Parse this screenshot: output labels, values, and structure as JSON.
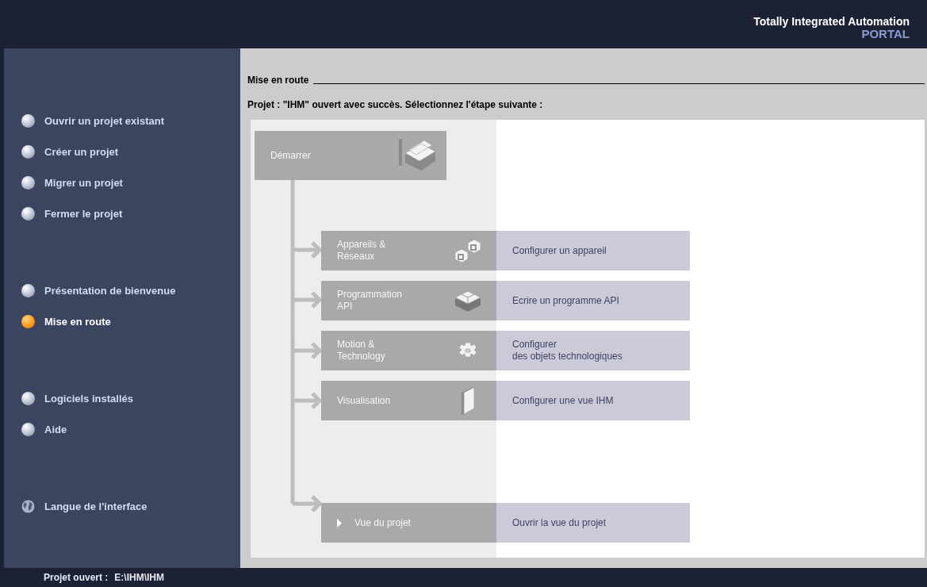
{
  "header": {
    "title": "Totally Integrated Automation",
    "subtitle": "PORTAL"
  },
  "sidebar": {
    "groups": [
      [
        {
          "label": "Ouvrir un projet existant",
          "kind": "bullet",
          "selected": false
        },
        {
          "label": "Créer un projet",
          "kind": "bullet",
          "selected": false
        },
        {
          "label": "Migrer un projet",
          "kind": "bullet",
          "selected": false
        },
        {
          "label": "Fermer le projet",
          "kind": "bullet",
          "selected": false
        }
      ],
      [
        {
          "label": "Présentation de bienvenue",
          "kind": "bullet",
          "selected": false
        },
        {
          "label": "Mise en route",
          "kind": "bullet",
          "selected": true
        }
      ],
      [
        {
          "label": "Logiciels installés",
          "kind": "bullet",
          "selected": false
        },
        {
          "label": "Aide",
          "kind": "bullet",
          "selected": false
        }
      ],
      [
        {
          "label": "Langue de l'interface",
          "kind": "globe",
          "selected": false
        }
      ]
    ]
  },
  "main": {
    "title": "Mise en route",
    "message": "Projet : \"IHM\" ouvert avec succès. Sélectionnez l'étape suivante :",
    "start": {
      "label": "Démarrer"
    },
    "steps": [
      {
        "kind": "step",
        "label": "Appareils &\nRéseaux",
        "action": "Configurer un appareil"
      },
      {
        "kind": "step",
        "label": "Programmation\nAPI",
        "action": "Ecrire un programme API"
      },
      {
        "kind": "step",
        "label": "Motion &\nTechnology",
        "action": "Configurer\ndes objets technologiques"
      },
      {
        "kind": "step",
        "label": "Visualisation",
        "action": "Configurer une vue IHM"
      },
      {
        "kind": "view",
        "label": "Vue du projet",
        "action": "Ouvrir la vue du projet"
      }
    ]
  },
  "status_bar": {
    "label": "Projet ouvert :",
    "path": "E:\\IHM\\IHM"
  }
}
